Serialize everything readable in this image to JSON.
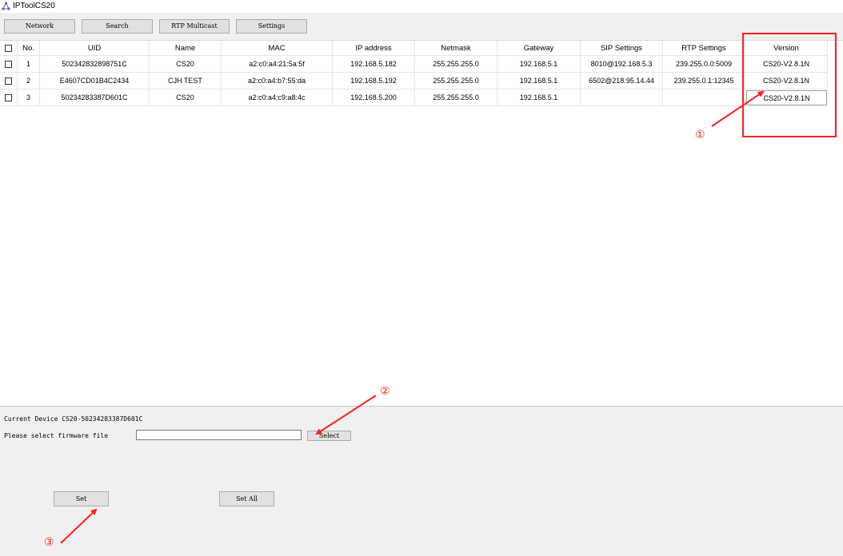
{
  "window": {
    "title": "IPToolCS20"
  },
  "toolbar": {
    "network_label": "Network",
    "search_label": "Search",
    "rtp_multicast_label": "RTP Multicast",
    "settings_label": "Settings"
  },
  "table": {
    "columns": [
      "No.",
      "UID",
      "Name",
      "MAC",
      "IP address",
      "Netmask",
      "Gateway",
      "SIP Settings",
      "RTP Settings",
      "Version"
    ],
    "rows": [
      {
        "no": "1",
        "uid": "502342832898751C",
        "name": "CS20",
        "mac": "a2:c0:a4:21:5a:5f",
        "ip": "192.168.5.182",
        "netmask": "255.255.255.0",
        "gateway": "192.168.5.1",
        "sip": "8010@192.168.5.3",
        "rtp": "239.255.0.0:5009",
        "version": "CS20-V2.8.1N"
      },
      {
        "no": "2",
        "uid": "E4607CD01B4C2434",
        "name": "CJH TEST",
        "mac": "a2:c0:a4:b7:55:da",
        "ip": "192.168.5.192",
        "netmask": "255.255.255.0",
        "gateway": "192.168.5.1",
        "sip": "6502@218.95.14.44",
        "rtp": "239.255.0.1:12345",
        "version": "CS20-V2.8.1N"
      },
      {
        "no": "3",
        "uid": "50234283387D601C",
        "name": "CS20",
        "mac": "a2:c0:a4:c9:a8:4c",
        "ip": "192.168.5.200",
        "netmask": "255.255.255.0",
        "gateway": "192.168.5.1",
        "sip": "",
        "rtp": "",
        "version": "CS20-V2.8.1N"
      }
    ]
  },
  "firmware": {
    "current_device_label": "Current Device CS20-50234283387D601C",
    "select_file_label": "Please select firmware file",
    "file_value": "",
    "select_button": "Select",
    "set_button": "Set",
    "set_all_button": "Set All"
  },
  "annotations": {
    "step1": "①",
    "step2": "②",
    "step3": "③",
    "color": "#ff2020"
  }
}
